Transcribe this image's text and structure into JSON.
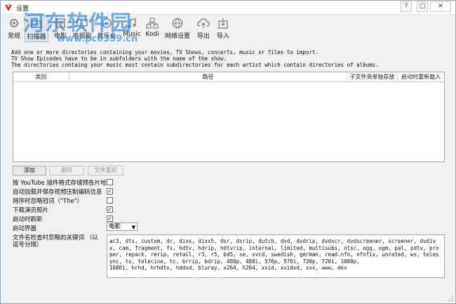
{
  "window": {
    "title": "设置",
    "controls": {
      "help": "?",
      "minimize": "▢",
      "close": "✕"
    }
  },
  "watermark": {
    "text": "河东软件园",
    "url": "www.pc0359.cn"
  },
  "toolbar": {
    "items": [
      {
        "label": "常规",
        "icon": "gear-icon"
      },
      {
        "label": "扫描器",
        "icon": "scanner-icon"
      },
      {
        "label": "电影",
        "icon": "film-icon"
      },
      {
        "label": "电视剧",
        "icon": "tv-icon"
      },
      {
        "label": "音乐会",
        "icon": "concert-icon"
      },
      {
        "label": "Music",
        "icon": "music-icon"
      },
      {
        "label": "Kodi",
        "icon": "network-icon"
      },
      {
        "label": "网络设置",
        "icon": "globe-icon"
      },
      {
        "label": "导出",
        "icon": "cloud-upload-icon"
      },
      {
        "label": "导入",
        "icon": "import-icon"
      }
    ]
  },
  "description": {
    "line1": "Add one or more directories containing your movies, TV Shows, concerts, music or files to import.",
    "line2": "TV Show Episodes have to be in subfolders with the name of the show.",
    "line3": "The directories containg your music must contain subdirectories for each artist which contain directories of albums."
  },
  "table": {
    "columns": [
      "类别",
      "路径",
      "子文件夹单独存放",
      "启动时重新载入"
    ],
    "rows": []
  },
  "buttons": {
    "add": "添加",
    "remove": "删除",
    "regroup": "文件重组"
  },
  "options": [
    {
      "label": "按 YouTube 插件格式存储预告片地址",
      "checked": false
    },
    {
      "label": "自动加载并保存视频压制编码信息",
      "checked": true
    },
    {
      "label": "排序时忽略冠词（\"The\"）",
      "checked": false
    },
    {
      "label": "下载演员照片",
      "checked": true
    },
    {
      "label": "启动时刷新",
      "checked": true
    }
  ],
  "startup": {
    "label": "启动界面",
    "value": "电影"
  },
  "ignore": {
    "label": "文件名检查时忽略的关键词 （以逗号分隔）",
    "value": "ac3, dts, custom, dc, divx, divx5, dsr, dsrip, dutch, dvd, dvdrip, dvdscr, dvdscreener, screener, dvdivx, cam, fragment, fs, hdtv, hdrip, hdtvrip, internal, limited, multisubs, ntsc, ogg, ogm, pal, pdtv, proper, repack, rerip, retail, r3, r5, bd5, se, svcd, swedish, german, read.nfo, nfofix, unrated, ws, telesync, ts, telecine, tc, brrip, bdrip, 480p, 480i, 576p, 576i, 720p, 720i, 1080p,\n1080i, hrhd, hrhdtv, hddvd, bluray, x264, h264, xvid, xvidvd, xxx, www, mkv"
  },
  "colors": {
    "accent": "#1a7ed6",
    "selected_tab": "#dde6f2",
    "icon": "#8a8a8a"
  }
}
